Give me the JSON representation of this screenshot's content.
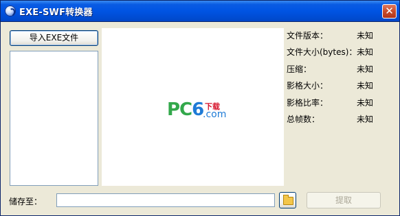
{
  "window": {
    "title": "EXE-SWF转换器",
    "close_glyph": "✕"
  },
  "left": {
    "import_button": "导入EXE文件"
  },
  "preview": {
    "logo_pc": "PC",
    "logo_six": "6",
    "logo_xz": "下载",
    "logo_com": ".com"
  },
  "info": [
    {
      "label": "文件版本：",
      "value": "未知"
    },
    {
      "label": "文件大小(bytes)：",
      "value": "未知"
    },
    {
      "label": "压缩：",
      "value": "未知"
    },
    {
      "label": "影格大小：",
      "value": "未知"
    },
    {
      "label": "影格比率：",
      "value": "未知"
    },
    {
      "label": "总帧数：",
      "value": "未知"
    }
  ],
  "bottom": {
    "save_label": "储存至：",
    "save_value": "",
    "extract_button": "提取"
  }
}
